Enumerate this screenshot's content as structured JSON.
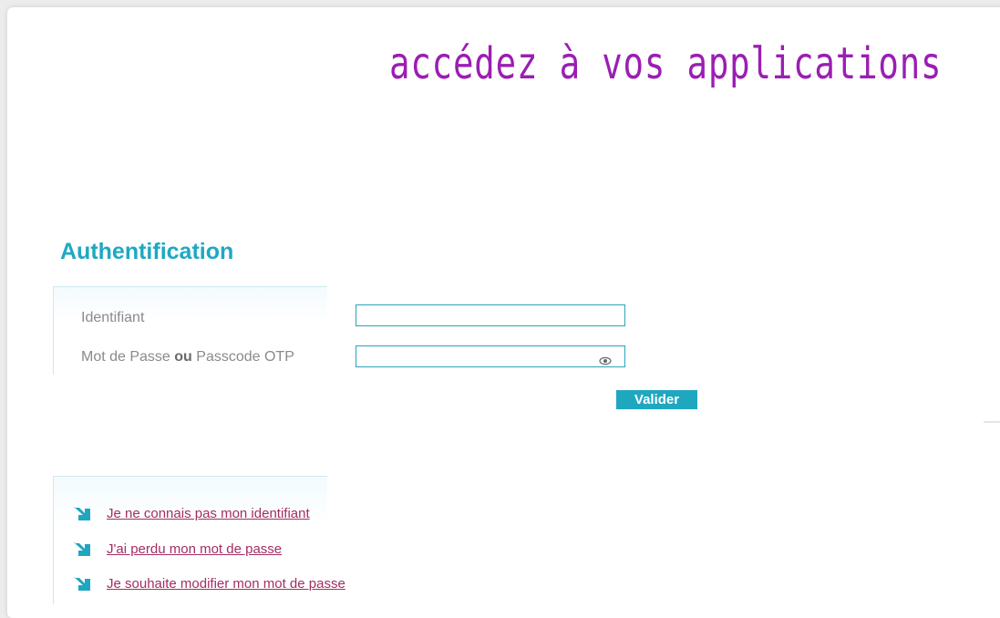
{
  "header": {
    "title": "accédez à vos applications"
  },
  "auth": {
    "title": "Authentification",
    "identifier_label": "Identifiant",
    "password_label_part1": "Mot de Passe ",
    "password_label_or": "ou",
    "password_label_part2": " Passcode OTP",
    "identifier_value": "",
    "password_value": "",
    "submit_label": "Valider",
    "password_toggle_icon": "eye-icon"
  },
  "help_links": [
    {
      "label": "Je ne connais pas mon identifiant",
      "icon": "arrow-down-right-icon"
    },
    {
      "label": "J'ai perdu mon mot de passe",
      "icon": "arrow-down-right-icon"
    },
    {
      "label": "Je souhaite modifier mon mot de passe",
      "icon": "arrow-down-right-icon"
    }
  ],
  "colors": {
    "title_purple": "#9b1eb3",
    "accent_teal": "#1fa7c0",
    "link_red": "#a32d63"
  }
}
